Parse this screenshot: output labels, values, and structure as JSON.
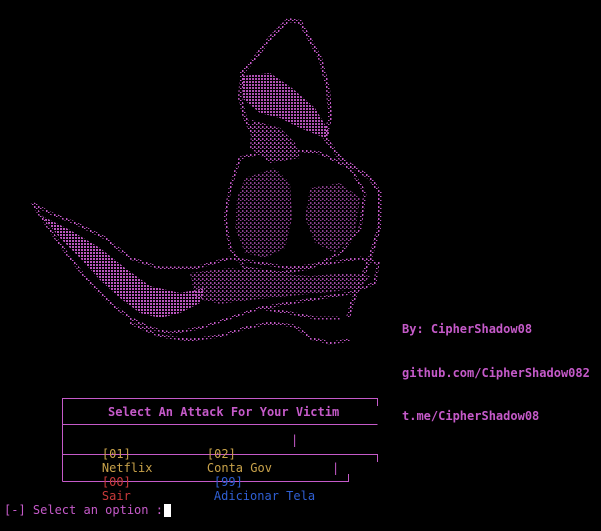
{
  "credits": {
    "author": "By: CipherShadow08",
    "github": "github.com/CipherShadow082",
    "telegram": "t.me/CipherShadow08"
  },
  "menu": {
    "title": "Select An Attack For Your Victim",
    "options": [
      {
        "code": "[01]",
        "label": "Netflix"
      },
      {
        "code": "[02]",
        "label": "Conta Gov"
      },
      {
        "code": "[00]",
        "label": "Sair"
      },
      {
        "code": "[99]",
        "label": "Adicionar Tela"
      }
    ],
    "separator": "|"
  },
  "prompt": {
    "text": "[-] Select an option :"
  },
  "colors": {
    "magenta": "#c55ac9",
    "yellow": "#c8a24a",
    "red": "#c83a3a",
    "blue": "#2f5fd4",
    "background": "#000000"
  },
  "icons": {
    "art": "hooded-figure-ascii-art-icon"
  }
}
